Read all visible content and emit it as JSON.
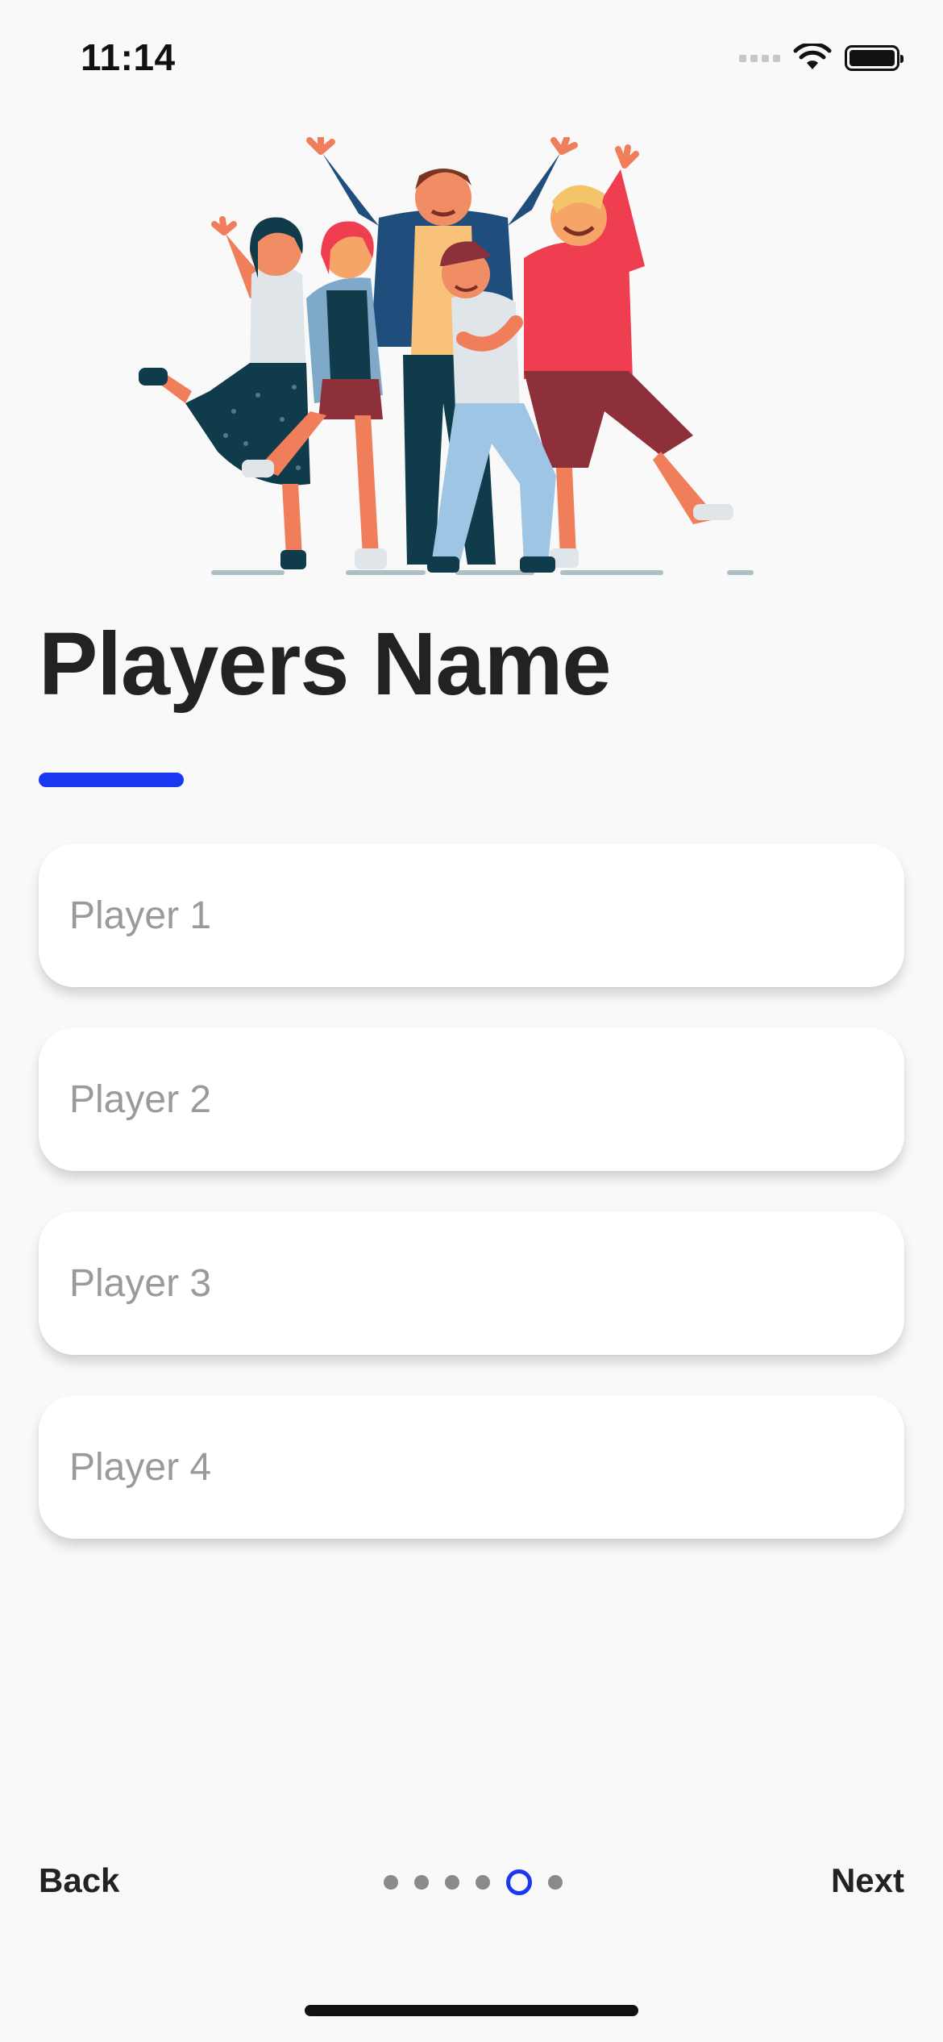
{
  "status_bar": {
    "time": "11:14"
  },
  "hero": {
    "illustration": "group-of-friends-cheering"
  },
  "header": {
    "title": "Players Name",
    "accent_color": "#1a38f0"
  },
  "players": [
    {
      "placeholder": "Player 1",
      "value": ""
    },
    {
      "placeholder": "Player 2",
      "value": ""
    },
    {
      "placeholder": "Player 3",
      "value": ""
    },
    {
      "placeholder": "Player 4",
      "value": ""
    }
  ],
  "navigation": {
    "back_label": "Back",
    "next_label": "Next",
    "page_count": 6,
    "current_page": 5
  }
}
